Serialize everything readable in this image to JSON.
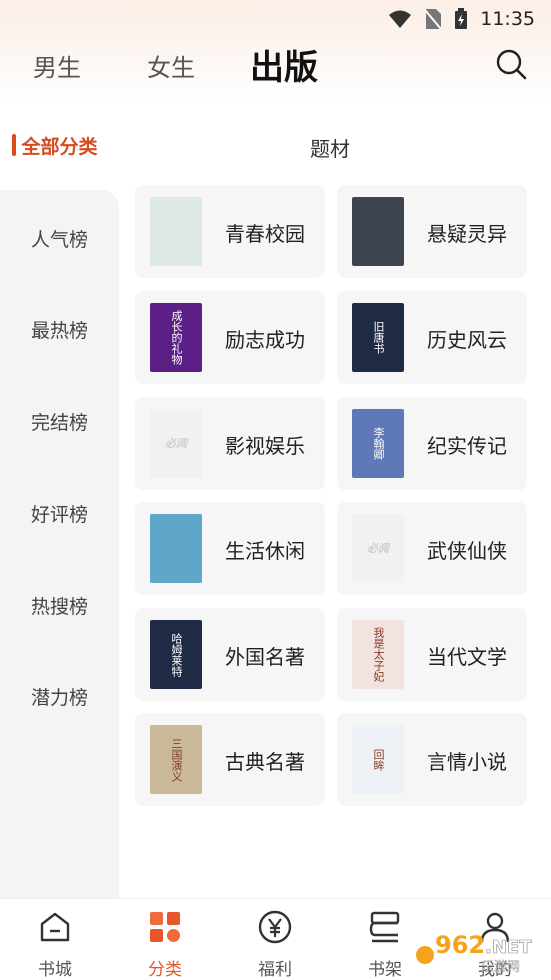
{
  "status": {
    "time": "11:35"
  },
  "top_tabs": [
    {
      "label": "男生"
    },
    {
      "label": "女生"
    },
    {
      "label": "出版"
    }
  ],
  "sidebar": {
    "items": [
      {
        "label": "全部分类"
      },
      {
        "label": "人气榜"
      },
      {
        "label": "最热榜"
      },
      {
        "label": "完结榜"
      },
      {
        "label": "好评榜"
      },
      {
        "label": "热搜榜"
      },
      {
        "label": "潜力榜"
      }
    ]
  },
  "section": {
    "title": "题材"
  },
  "categories": [
    {
      "label": "青春校园",
      "cover_color": "#dfe9e4"
    },
    {
      "label": "悬疑灵异",
      "cover_color": "#3d4550"
    },
    {
      "label": "励志成功",
      "cover_color": "#5b1f86",
      "cover_text": "成长的礼物"
    },
    {
      "label": "历史风云",
      "cover_color": "#1f2a44",
      "cover_text": "旧唐书"
    },
    {
      "label": "影视娱乐",
      "cover_color": "#f1f1f1",
      "cover_text": "必阅"
    },
    {
      "label": "纪实传记",
      "cover_color": "#5e78b8",
      "cover_text": "李翰卿"
    },
    {
      "label": "生活休闲",
      "cover_color": "#5fa7c9"
    },
    {
      "label": "武侠仙侠",
      "cover_color": "#f1f1f1",
      "cover_text": "必阅"
    },
    {
      "label": "外国名著",
      "cover_color": "#1f2a44",
      "cover_text": "哈姆莱特"
    },
    {
      "label": "当代文学",
      "cover_color": "#f2e3e0",
      "cover_text": "我是太子妃"
    },
    {
      "label": "古典名著",
      "cover_color": "#c9b89a",
      "cover_text": "三国演义"
    },
    {
      "label": "言情小说",
      "cover_color": "#eef2f6",
      "cover_text": "回眸"
    }
  ],
  "bottom_nav": [
    {
      "label": "书城",
      "icon": "home-icon"
    },
    {
      "label": "分类",
      "icon": "category-icon"
    },
    {
      "label": "福利",
      "icon": "yen-icon"
    },
    {
      "label": "书架",
      "icon": "bookshelf-icon"
    },
    {
      "label": "我的",
      "icon": "profile-icon"
    }
  ],
  "watermark": {
    "text": "962.NET",
    "subtext": "乐游网"
  },
  "colors": {
    "accent": "#e5572a",
    "sidebar_active": "#d94b1d"
  }
}
